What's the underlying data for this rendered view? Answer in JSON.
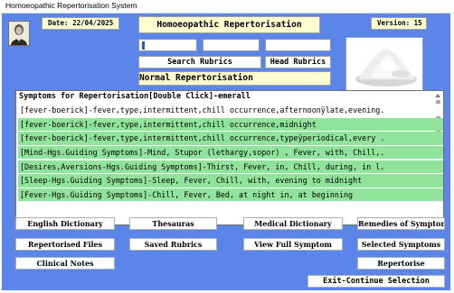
{
  "window": {
    "title": "Homoeopathic Repertorisation System"
  },
  "header": {
    "date_label": "Date: 22/04/2025",
    "app_title": "Homoeopathic Repertorisation",
    "version_label": "Version: 15"
  },
  "search": {
    "search_rubrics_label": "Search Rubrics",
    "head_rubrics_label": "Head Rubrics"
  },
  "mode_label": "Normal Repertorisation",
  "symptoms": {
    "heading": "Symptoms for Repertorisation[Double Click]-emerall",
    "rows": [
      {
        "text": "[fever-boerick]-fever,type,intermittent,chill occurrence,afternoonÿlate,evening.",
        "selected": false
      },
      {
        "text": "[fever-boerick]-fever,type,intermittent,chill occurrence,midnight",
        "selected": true
      },
      {
        "text": "[fever-boerick]-fever,type,intermittent,chill occurrence,typeÿperiodical,every .",
        "selected": true
      },
      {
        "text": "[Mind-Hgs.Guiding Symptoms]-Mind, Stupor (lethargy,sopor) , Fever, with, Chill,.",
        "selected": true
      },
      {
        "text": "[Desires,Aversions-Hgs.Guiding Symptoms]-Thirst, Fever, in, Chill, during, in l.",
        "selected": true
      },
      {
        "text": "[Sleep-Hgs.Guiding Symptoms]-Sleep, Fever, Chill, with, evening to midnight",
        "selected": true
      },
      {
        "text": "[Fever-Hgs.Guiding Symptoms]-Chill, Fever, Bed, at night in, at beginning",
        "selected": true
      }
    ]
  },
  "buttons": {
    "english_dictionary": "English Dictionary",
    "thesauras": "Thesauras",
    "medical_dictionary": "Medical Dictionary",
    "remedies_of_symptom": "Remedies of Sympton",
    "repertorised_files": "Repertorised Files",
    "saved_rubrics": "Saved Rubrics",
    "view_full_symptom": "View Full Symptom",
    "selected_symptoms": "Selected Symptoms",
    "clinical_notes": "Clinical Notes",
    "repertorise": "Repertorise",
    "exit_continue": "Exit-Continue Selection"
  },
  "colors": {
    "client_bg": "#5b85e8",
    "header_box_bg": "#fdfdd0",
    "selected_row_bg": "#8fe39a",
    "caret": "#1e5ad6"
  },
  "icons": {
    "portrait": "portrait-image",
    "powder": "powder-image"
  }
}
